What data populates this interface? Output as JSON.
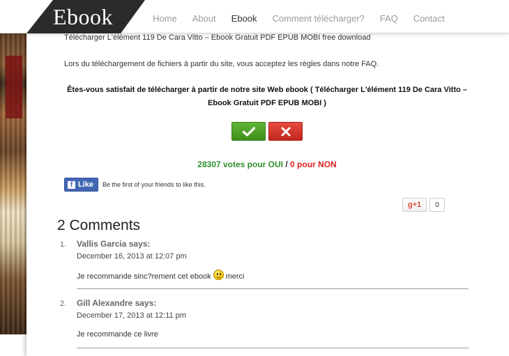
{
  "header": {
    "logo": "Ebook",
    "nav": [
      {
        "label": "Home",
        "active": false
      },
      {
        "label": "About",
        "active": false
      },
      {
        "label": "Ebook",
        "active": true
      },
      {
        "label": "Comment télécharger?",
        "active": false
      },
      {
        "label": "FAQ",
        "active": false
      },
      {
        "label": "Contact",
        "active": false
      }
    ]
  },
  "main": {
    "title_line": "Télécharger L'élément 119 De Cara Vitto – Ebook Gratuit PDF EPUB MOBI  free download",
    "rules_line": "Lors du téléchargement de fichiers à partir du site, vous acceptez les règles dans notre FAQ.",
    "question_line1": "Êtes-vous satisfait de télécharger à partir de notre site Web ebook ( Télécharger L'élément 119 De Cara Vitto –",
    "question_line2": "Ebook Gratuit PDF EPUB MOBI )",
    "vote_yes_icon": "check-icon",
    "vote_no_icon": "x-icon",
    "votes_yes": "28307 votes pour OUI",
    "votes_sep": " / ",
    "votes_no": "0 pour NON",
    "colors": {
      "yes": "#2f8f2f",
      "no": "#e02020",
      "accent_dark": "#2b2b2b",
      "facebook": "#4267b2",
      "gplus": "#dd4b39"
    }
  },
  "social": {
    "fb_like_label": "Like",
    "fb_text": "Be the first of your friends to like this.",
    "gplus_label": "g+1",
    "gplus_count": "0"
  },
  "comments": {
    "title": "2 Comments",
    "items": [
      {
        "num": "1.",
        "author": "Vallis Garcia says:",
        "date": "December 16, 2013 at 12:07 pm",
        "text": "Je recommande sinc?rement cet ebook",
        "text_after": "merci",
        "emoji": "smiley-icon"
      },
      {
        "num": "2.",
        "author": "Gill Alexandre says:",
        "date": "December 17, 2013 at 12:11 pm",
        "text": "Je recommande ce livre",
        "text_after": "",
        "emoji": ""
      }
    ]
  }
}
